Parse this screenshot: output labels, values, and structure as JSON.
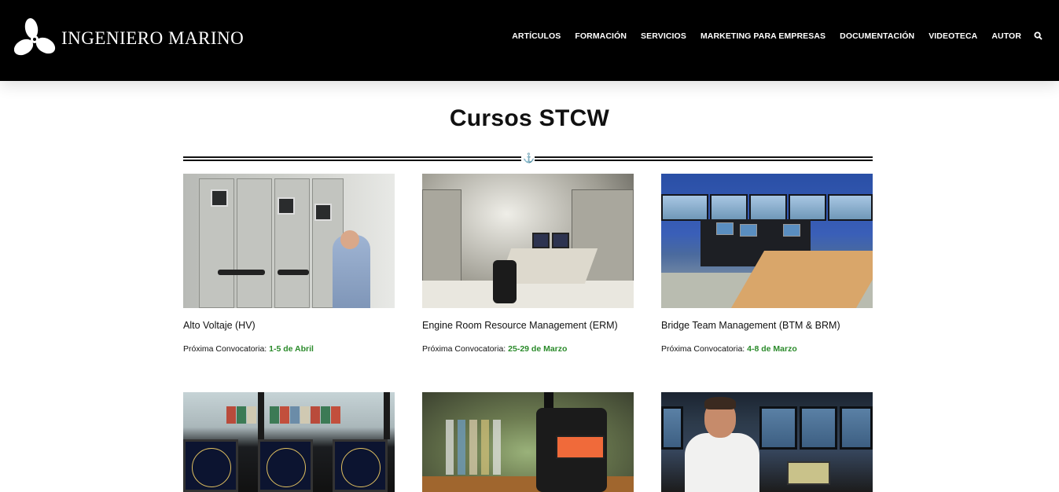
{
  "header": {
    "logo_text": "INGENIERO MARINO",
    "nav": [
      "ARTÍCULOS",
      "FORMACIÓN",
      "SERVICIOS",
      "MARKETING PARA EMPRESAS",
      "DOCUMENTACIÓN",
      "VIDEOTECA",
      "AUTOR"
    ]
  },
  "page": {
    "title": "Cursos STCW"
  },
  "colors": {
    "header_bg": "#000000",
    "date_green": "#2a8a2a"
  },
  "courses": [
    {
      "title": "Alto Voltaje (HV)",
      "next_label": "Próxima Convocatoria:",
      "next_date": "1-5 de Abril",
      "image": "switchboard-photo"
    },
    {
      "title": "Engine Room Resource Management (ERM)",
      "next_label": "Próxima Convocatoria:",
      "next_date": "25-29 de Marzo",
      "image": "engine-room-photo"
    },
    {
      "title": "Bridge Team Management (BTM & BRM)",
      "next_label": "Próxima Convocatoria:",
      "next_date": "4-8  de Marzo",
      "image": "bridge-simulator-photo"
    },
    {
      "image": "bridge-radar-photo"
    },
    {
      "image": "handheld-radio-photo"
    },
    {
      "image": "officer-radio-photo"
    }
  ]
}
